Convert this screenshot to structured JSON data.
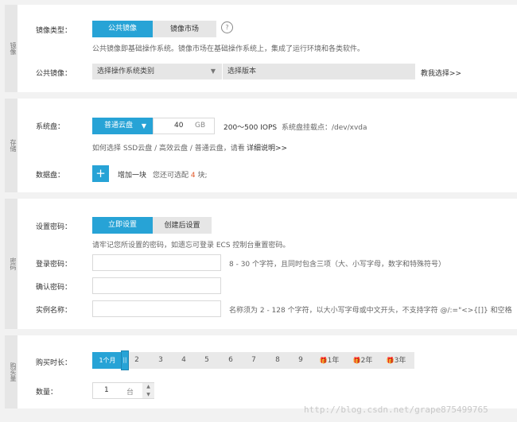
{
  "image_section": {
    "side_label": "镜像",
    "type_label": "镜像类型：",
    "tabs": [
      "公共镜像",
      "镜像市场"
    ],
    "help_icon": "help-circle-icon",
    "description": "公共镜像即基础操作系统。镜像市场在基础操作系统上，集成了运行环境和各类软件。",
    "public_label": "公共镜像：",
    "os_select": "选择操作系统类别",
    "version_select": "选择版本",
    "help_choose": "教我选择>>"
  },
  "storage_section": {
    "side_label": "存储",
    "system_disk_label": "系统盘：",
    "disk_type": "普通云盘",
    "size_value": "40",
    "size_unit": "GB",
    "iops": "200～500 IOPS",
    "mount_point": "系统盘挂载点：/dev/xvda",
    "how_to_choose": "如何选择 SSD云盘 / 高效云盘 / 普通云盘，请看",
    "detail_link": "详细说明>>",
    "data_disk_label": "数据盘：",
    "add_label": "增加一块",
    "remain_prefix": "您还可选配",
    "remain_count": "4",
    "remain_suffix": "块;"
  },
  "password_section": {
    "side_label": "密码",
    "set_label": "设置密码：",
    "tabs": [
      "立即设置",
      "创建后设置"
    ],
    "reminder": "请牢记您所设置的密码，如遗忘可登录 ECS 控制台重置密码。",
    "login_pwd_label": "登录密码：",
    "login_pwd_hint": "8 - 30 个字符，且同时包含三项（大、小写字母，数字和特殊符号）",
    "confirm_label": "确认密码：",
    "instance_label": "实例名称：",
    "instance_hint": "名称须为 2 - 128 个字符，以大小写字母或中文开头，不支持字符 @/:=\"<>{[]} 和空格"
  },
  "purchase_section": {
    "side_label": "购买量",
    "duration_label": "购买时长：",
    "durations": [
      "1个月",
      "2",
      "3",
      "4",
      "5",
      "6",
      "7",
      "8",
      "9",
      "1年",
      "2年",
      "3年"
    ],
    "quantity_label": "数量：",
    "quantity_value": "1",
    "quantity_unit": "台"
  },
  "watermark": "http://blog.csdn.net/grape875499765"
}
